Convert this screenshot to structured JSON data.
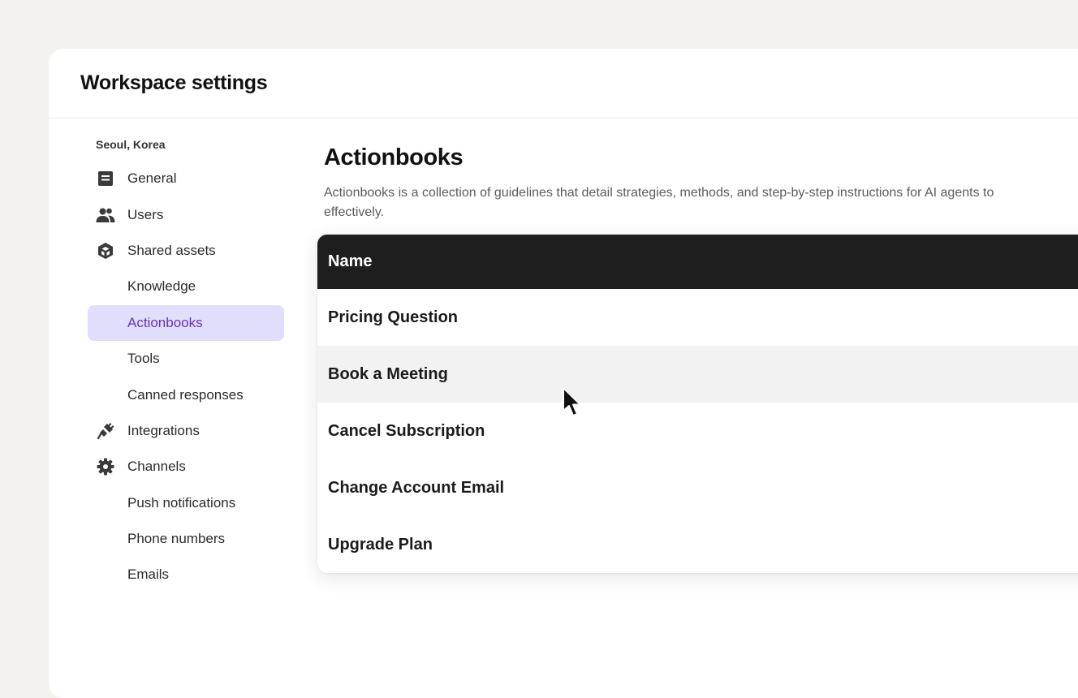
{
  "window": {
    "title": "Workspace settings"
  },
  "sidebar": {
    "location": "Seoul, Korea",
    "items": [
      {
        "label": "General",
        "icon": "document-icon",
        "active": false
      },
      {
        "label": "Users",
        "icon": "users-icon",
        "active": false
      },
      {
        "label": "Shared assets",
        "icon": "cube-icon",
        "active": false
      },
      {
        "label": "Knowledge",
        "icon": "",
        "active": false
      },
      {
        "label": "Actionbooks",
        "icon": "",
        "active": true
      },
      {
        "label": "Tools",
        "icon": "",
        "active": false
      },
      {
        "label": "Canned responses",
        "icon": "",
        "active": false
      },
      {
        "label": "Integrations",
        "icon": "plug-icon",
        "active": false
      },
      {
        "label": "Channels",
        "icon": "gear-icon",
        "active": false
      },
      {
        "label": "Push notifications",
        "icon": "",
        "active": false
      },
      {
        "label": "Phone numbers",
        "icon": "",
        "active": false
      },
      {
        "label": "Emails",
        "icon": "",
        "active": false
      }
    ]
  },
  "main": {
    "title": "Actionbooks",
    "description_line1": "Actionbooks is a collection of guidelines that detail strategies, methods, and step-by-step instructions for AI agents to",
    "description_line2": "effectively.",
    "table": {
      "header": "Name",
      "rows": [
        {
          "name": "Pricing Question",
          "hovered": false
        },
        {
          "name": "Book a Meeting",
          "hovered": true
        },
        {
          "name": "Cancel Subscription",
          "hovered": false
        },
        {
          "name": "Change Account Email",
          "hovered": false
        },
        {
          "name": "Upgrade Plan",
          "hovered": false
        }
      ]
    }
  },
  "colors": {
    "page_background": "#f3f2ee",
    "active_item_background": "#e1defc",
    "active_item_text": "#6a32b8",
    "table_header_background": "#1e1e1e",
    "hover_row_background": "#f2f2f2"
  },
  "cursor": {
    "icon": "mouse-pointer-icon"
  }
}
